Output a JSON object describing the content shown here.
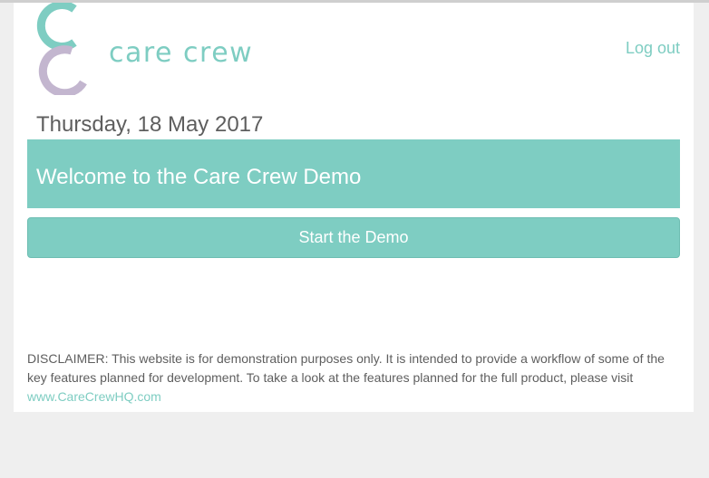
{
  "header": {
    "brand_name": "care crew",
    "logout_label": "Log out"
  },
  "main": {
    "date": "Thursday, 18 May 2017",
    "welcome_title": "Welcome to the Care Crew Demo",
    "start_button_label": "Start the Demo"
  },
  "footer": {
    "disclaimer_text": "DISCLAIMER: This website is for demonstration purposes only. It is intended to provide a workflow of some of the key features planned for development. To take a look at the features planned for the full product, please visit",
    "link_text": "www.CareCrewHQ.com"
  },
  "colors": {
    "accent": "#7ecdc2",
    "logo_purple": "#c3b6cf",
    "text": "#5e5e5e",
    "background": "#efefef"
  },
  "icons": {
    "logo_mark": "care-crew-logo-icon"
  }
}
